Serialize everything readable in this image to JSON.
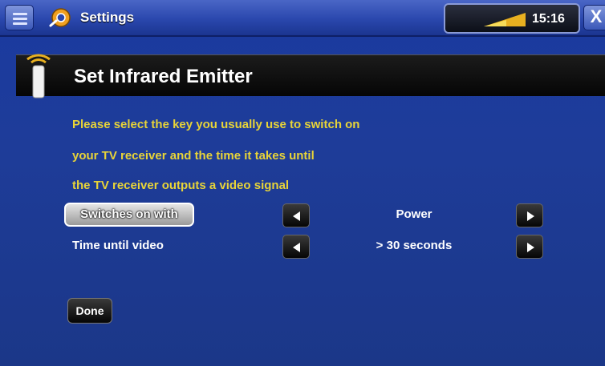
{
  "topbar": {
    "app_title": "Settings",
    "clock": "15:16",
    "close_label": "X",
    "menu_icon": "menu-icon",
    "settings_icon": "settings-gear-icon",
    "signal_icon": "signal-strength-icon"
  },
  "header": {
    "title": "Set Infrared Emitter",
    "icon": "remote-control-icon"
  },
  "instructions": [
    "Please select the key you usually use to switch on",
    "your TV receiver and the time it takes until",
    "the TV receiver outputs a video signal"
  ],
  "rows": [
    {
      "label": "Switches on with",
      "value": "Power"
    },
    {
      "label": "Time until video",
      "value": "> 30 seconds"
    }
  ],
  "done_label": "Done",
  "colors": {
    "background": "#1e3c99",
    "instruction_text": "#e8d438",
    "header_band": "#0a0a0a"
  }
}
